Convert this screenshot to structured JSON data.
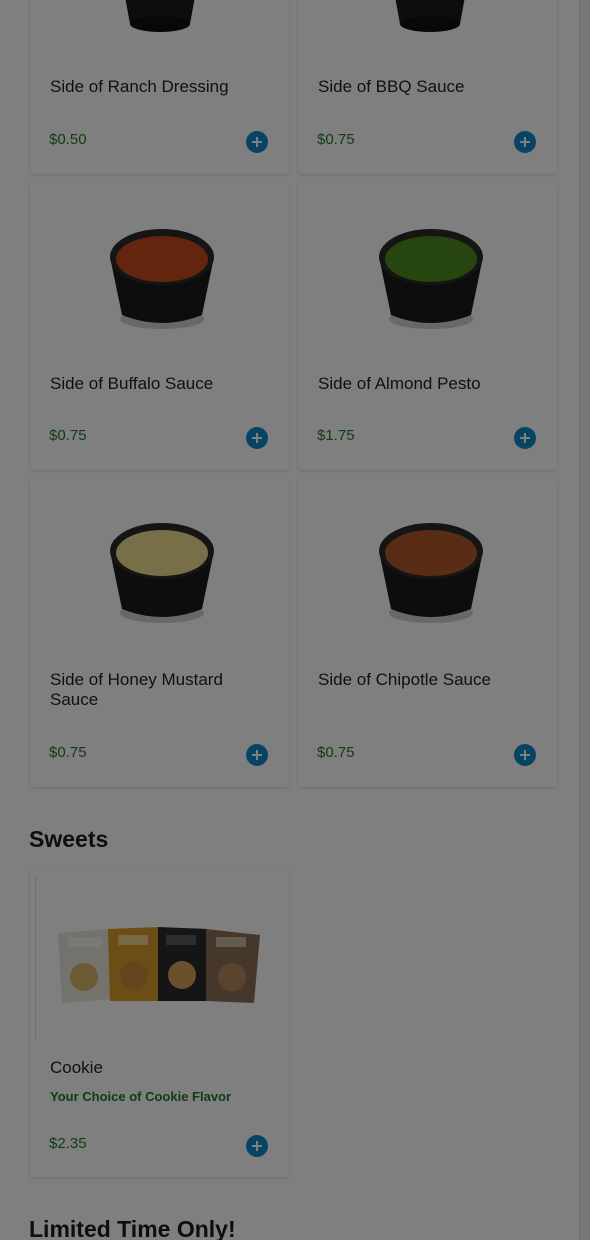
{
  "sauces": [
    {
      "name": "Side of Ranch Dressing",
      "price": "$0.50",
      "color": "#f3f0e6"
    },
    {
      "name": "Side of BBQ Sauce",
      "price": "$0.75",
      "color": "#5a1e12"
    },
    {
      "name": "Side of Buffalo Sauce",
      "price": "$0.75",
      "color": "#c94a1f"
    },
    {
      "name": "Side of Almond Pesto",
      "price": "$1.75",
      "color": "#4e8a1c"
    },
    {
      "name": "Side of Honey Mustard Sauce",
      "price": "$0.75",
      "color": "#f0df90"
    },
    {
      "name": "Side of Chipotle Sauce",
      "price": "$0.75",
      "color": "#b3582b"
    }
  ],
  "sweets": {
    "title": "Sweets",
    "items": [
      {
        "name": "Cookie",
        "description": "Your Choice of Cookie Flavor",
        "price": "$2.35"
      }
    ]
  },
  "limited": {
    "title": "Limited Time Only!"
  },
  "add_icon": "plus-circle-icon",
  "accent": "#0f89c8",
  "price_color": "#1e7a27"
}
